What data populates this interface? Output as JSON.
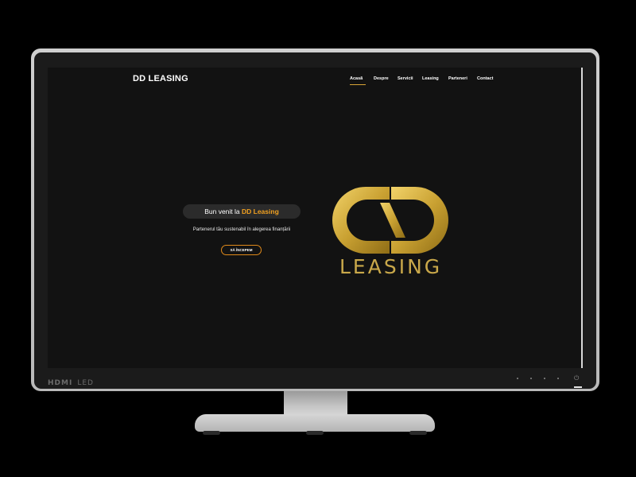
{
  "site": {
    "logo": "DD LEASING",
    "nav": [
      {
        "label": "Acasă",
        "active": true
      },
      {
        "label": "Despre",
        "active": false
      },
      {
        "label": "Servicii",
        "active": false
      },
      {
        "label": "Leasing",
        "active": false
      },
      {
        "label": "Parteneri",
        "active": false
      },
      {
        "label": "Contact",
        "active": false
      }
    ],
    "hero": {
      "welcome_prefix": "Bun venit la ",
      "welcome_brand": "DD Leasing",
      "subtitle": "Partenerul tău sustenabil în alegerea finanțării",
      "cta": "SĂ ÎNCEPEM"
    },
    "brand_logo_word": "LEASING"
  },
  "monitor": {
    "brand": "HDMI",
    "type": "LED",
    "power_icon": "power-icon"
  },
  "colors": {
    "accent": "#f0a020",
    "gold": "#c9a84a",
    "screen_bg": "#121212"
  }
}
